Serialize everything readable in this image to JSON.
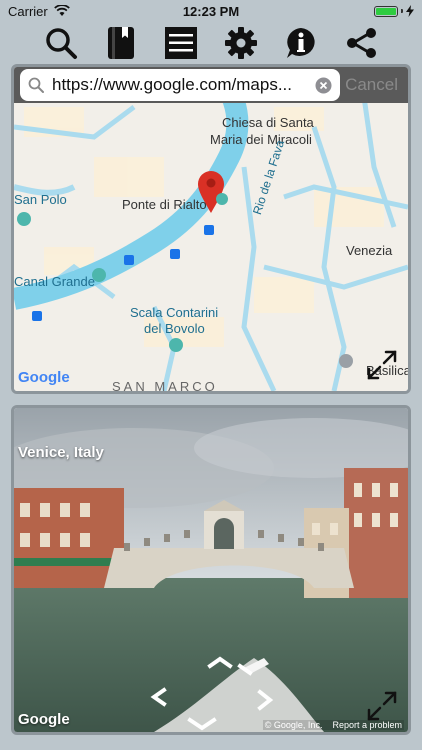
{
  "status": {
    "carrier": "Carrier",
    "time": "12:23 PM",
    "battery_level": 1.0
  },
  "toolbar": {
    "buttons": [
      {
        "icon": "search-icon"
      },
      {
        "icon": "book-icon"
      },
      {
        "icon": "list-icon"
      },
      {
        "icon": "gear-icon"
      },
      {
        "icon": "info-icon"
      },
      {
        "icon": "share-icon"
      }
    ]
  },
  "search": {
    "value": "https://www.google.com/maps...",
    "cancel_label": "Cancel"
  },
  "map": {
    "labels": {
      "chiesa": "Chiesa di Santa",
      "maria": "Maria dei Miracoli",
      "san_polo": "San Polo",
      "ponte": "Ponte di Rialto",
      "rio": "Rio de la Fava",
      "venezia": "Venezia",
      "canal_grande": "Canal Grande",
      "scala": "Scala Contarini",
      "bovolo": "del Bovolo",
      "basilica": "Basilica",
      "san_marco": "SAN MARCO"
    },
    "logo": "Google",
    "colors": {
      "land": "#f2efe9",
      "water": "#7fd0ea",
      "canal": "#aadbee",
      "pin": "#d93025"
    }
  },
  "streetview": {
    "location": "Venice, Italy",
    "logo": "Google",
    "copyright": "© Google, Inc.",
    "report": "Report a problem"
  }
}
